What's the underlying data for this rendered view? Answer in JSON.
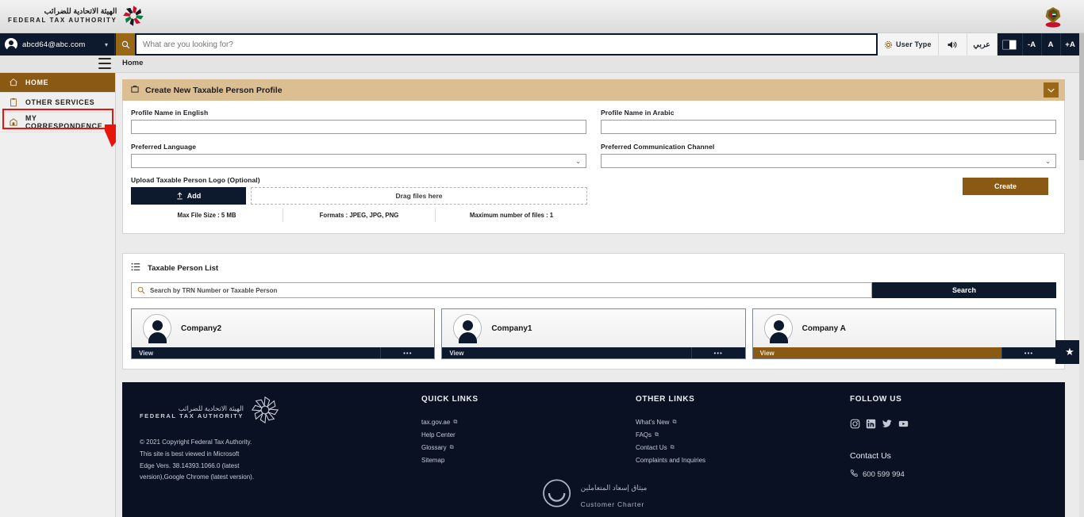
{
  "brand": {
    "name_ar": "الهيئة الاتحادية للضرائب",
    "name_en": "FEDERAL TAX AUTHORITY",
    "emblem_icon": "uae-emblem-icon",
    "logo_icon": "fta-logo-icon"
  },
  "topnav": {
    "user_email": "abcd64@abc.com",
    "user_chevron": "▾",
    "search_icon": "search-icon",
    "search_placeholder": "What are you looking for?",
    "search_value": "",
    "actions": [
      {
        "name": "user-type",
        "label": "User Type",
        "icon": "gear-icon"
      },
      {
        "name": "read-aloud",
        "label": "",
        "icon": "speaker-icon"
      },
      {
        "name": "arabic",
        "label": "عربي",
        "icon": ""
      },
      {
        "name": "contrast",
        "label": "",
        "icon": "contrast-icon"
      },
      {
        "name": "decrease-font",
        "label": "-A",
        "icon": ""
      },
      {
        "name": "normal-font",
        "label": "A",
        "icon": ""
      },
      {
        "name": "increase-font",
        "label": "+A",
        "icon": ""
      }
    ]
  },
  "breadcrumb": {
    "menu_icon": "hamburger-icon",
    "current": "Home"
  },
  "sidebar": {
    "items": [
      {
        "label": "HOME",
        "icon": "home-icon",
        "active": true
      },
      {
        "label": "OTHER SERVICES",
        "icon": "clipboard-icon",
        "active": false
      },
      {
        "label": "MY CORRESPONDENCE",
        "icon": "mailbox-icon",
        "active": false
      }
    ],
    "highlighted_item": "MY CORRESPONDENCE"
  },
  "panel": {
    "icon": "briefcase-icon",
    "title": "Create New Taxable Person Profile",
    "collapse_icon": "chevron-down-icon",
    "fields": {
      "profile_name_en_label": "Profile Name in English",
      "profile_name_en_value": "",
      "profile_name_ar_label": "Profile Name in Arabic",
      "profile_name_ar_value": "",
      "preferred_language_label": "Preferred Language",
      "preferred_language_value": "",
      "preferred_channel_label": "Preferred Communication Channel",
      "preferred_channel_value": ""
    },
    "upload": {
      "label": "Upload Taxable Person Logo (Optional)",
      "add_button": "Add",
      "add_icon": "upload-icon",
      "drop_text": "Drag files here",
      "hints": [
        "Max File Size : 5 MB",
        "Formats : JPEG, JPG, PNG",
        "Maximum number of files : 1"
      ]
    },
    "create_button": "Create"
  },
  "list": {
    "icon": "list-icon",
    "title": "Taxable Person List",
    "search_icon": "search-icon",
    "search_placeholder": "Search by TRN Number or Taxable Person",
    "search_value": "",
    "search_button": "Search",
    "cards": [
      {
        "name": "Company2",
        "view_label": "View",
        "more_label": "•••",
        "highlighted": false
      },
      {
        "name": "Company1",
        "view_label": "View",
        "more_label": "•••",
        "highlighted": false
      },
      {
        "name": "Company A",
        "view_label": "View",
        "more_label": "•••",
        "highlighted": true
      }
    ],
    "favorite_icon": "star-icon"
  },
  "footer": {
    "copyright_lines": [
      "© 2021 Copyright Federal Tax Authority.",
      "This site is best viewed in Microsoft",
      "Edge Vers. 38.14393.1066.0 (latest",
      "version),Google Chrome (latest version)."
    ],
    "quick_links": {
      "title": "QUICK LINKS",
      "items": [
        {
          "label": "tax.gov.ae",
          "external": true
        },
        {
          "label": "Help Center",
          "external": false
        },
        {
          "label": "Glossary",
          "external": true
        },
        {
          "label": "Sitemap",
          "external": false
        }
      ]
    },
    "other_links": {
      "title": "OTHER LINKS",
      "items": [
        {
          "label": "What's New",
          "external": true
        },
        {
          "label": "FAQs",
          "external": true
        },
        {
          "label": "Contact Us",
          "external": true
        },
        {
          "label": "Complaints and Inquiries",
          "external": false
        }
      ]
    },
    "follow": {
      "title": "FOLLOW US",
      "socials": [
        "instagram-icon",
        "linkedin-icon",
        "twitter-icon",
        "youtube-icon"
      ]
    },
    "contact": {
      "title": "Contact Us",
      "phone_icon": "phone-icon",
      "phone": "600 599 994"
    },
    "charter": {
      "icon": "smiley-icon",
      "text_ar": "ميثاق إسعاد المتعاملين",
      "text_en": "Customer Charter"
    }
  }
}
